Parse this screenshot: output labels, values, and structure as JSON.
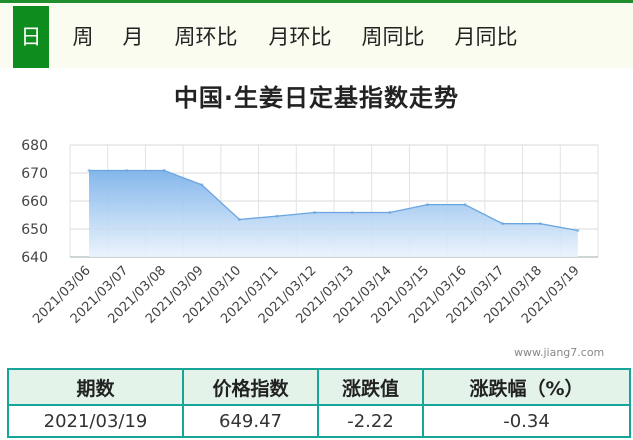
{
  "tabs": [
    {
      "label": "日",
      "active": true
    },
    {
      "label": "周",
      "active": false
    },
    {
      "label": "月",
      "active": false
    },
    {
      "label": "周环比",
      "active": false
    },
    {
      "label": "月环比",
      "active": false
    },
    {
      "label": "周同比",
      "active": false
    },
    {
      "label": "月同比",
      "active": false
    }
  ],
  "watermark": "www.jiang7.com",
  "table": {
    "headers": [
      "期数",
      "价格指数",
      "涨跌值",
      "涨跌幅（%）"
    ],
    "row": [
      "2021/03/19",
      "649.47",
      "-2.22",
      "-0.34"
    ]
  },
  "colors": {
    "accent": "#0e8c1d",
    "area_top": "#7db3ea",
    "line": "#6aa5e0",
    "table_border": "#17a59a"
  },
  "chart_data": {
    "type": "area",
    "title": "中国·生姜日定基指数走势",
    "xlabel": "",
    "ylabel": "",
    "ylim": [
      640,
      680
    ],
    "yticks": [
      640,
      650,
      660,
      670,
      680
    ],
    "grid": true,
    "categories": [
      "2021/03/06",
      "2021/03/07",
      "2021/03/08",
      "2021/03/09",
      "2021/03/10",
      "2021/03/11",
      "2021/03/12",
      "2021/03/13",
      "2021/03/14",
      "2021/03/15",
      "2021/03/16",
      "2021/03/17",
      "2021/03/18",
      "2021/03/19"
    ],
    "values": [
      670.9,
      670.9,
      670.9,
      665.8,
      653.4,
      654.6,
      655.9,
      655.9,
      655.9,
      658.7,
      658.7,
      651.9,
      651.9,
      649.47
    ]
  }
}
